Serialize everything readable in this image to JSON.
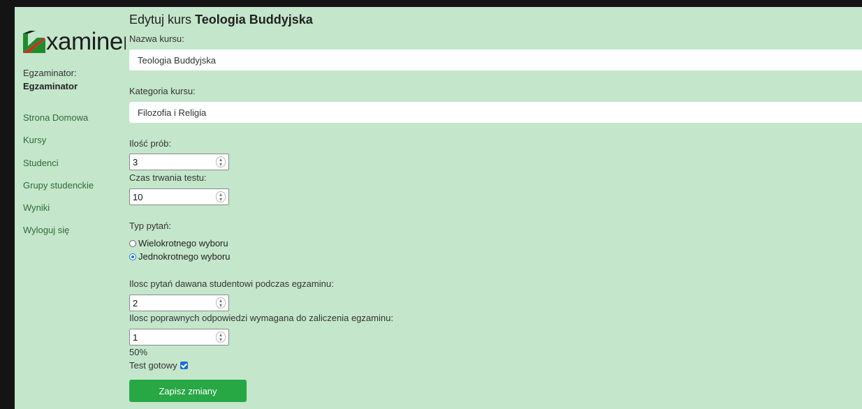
{
  "brand": {
    "logo_text": "xaminer"
  },
  "user": {
    "role_label": "Egzaminator:",
    "name": "Egzaminator"
  },
  "nav": {
    "items": [
      {
        "label": "Strona Domowa"
      },
      {
        "label": "Kursy"
      },
      {
        "label": "Studenci"
      },
      {
        "label": "Grupy studenckie"
      },
      {
        "label": "Wyniki"
      },
      {
        "label": "Wyloguj się"
      }
    ]
  },
  "page": {
    "title_prefix": "Edytuj kurs",
    "title_course": "Teologia Buddyjska"
  },
  "form": {
    "course_name_label": "Nazwa kursu:",
    "course_name_value": "Teologia Buddyjska",
    "category_label": "Kategoria kursu:",
    "category_value": "Filozofia i Religia",
    "attempts_label": "Ilość prób:",
    "attempts_value": "3",
    "duration_label": "Czas trwania testu:",
    "duration_value": "10",
    "question_type_label": "Typ pytań:",
    "question_type_options": [
      {
        "label": "Wielokrotnego wyboru",
        "checked": false
      },
      {
        "label": "Jednokrotnego wyboru",
        "checked": true
      }
    ],
    "questions_count_label": "Ilosc pytań dawana studentowi podczas egzaminu:",
    "questions_count_value": "2",
    "pass_count_label": "Ilosc poprawnych odpowiedzi wymagana do zaliczenia egzaminu:",
    "pass_count_value": "1",
    "pass_percent": "50%",
    "ready_label": "Test gotowy",
    "ready_checked": true,
    "submit_label": "Zapisz zmiany"
  },
  "colors": {
    "background": "#c4e6cb",
    "nav_link": "#2e6b34",
    "submit": "#28a745",
    "accent": "#1a6fd8"
  }
}
